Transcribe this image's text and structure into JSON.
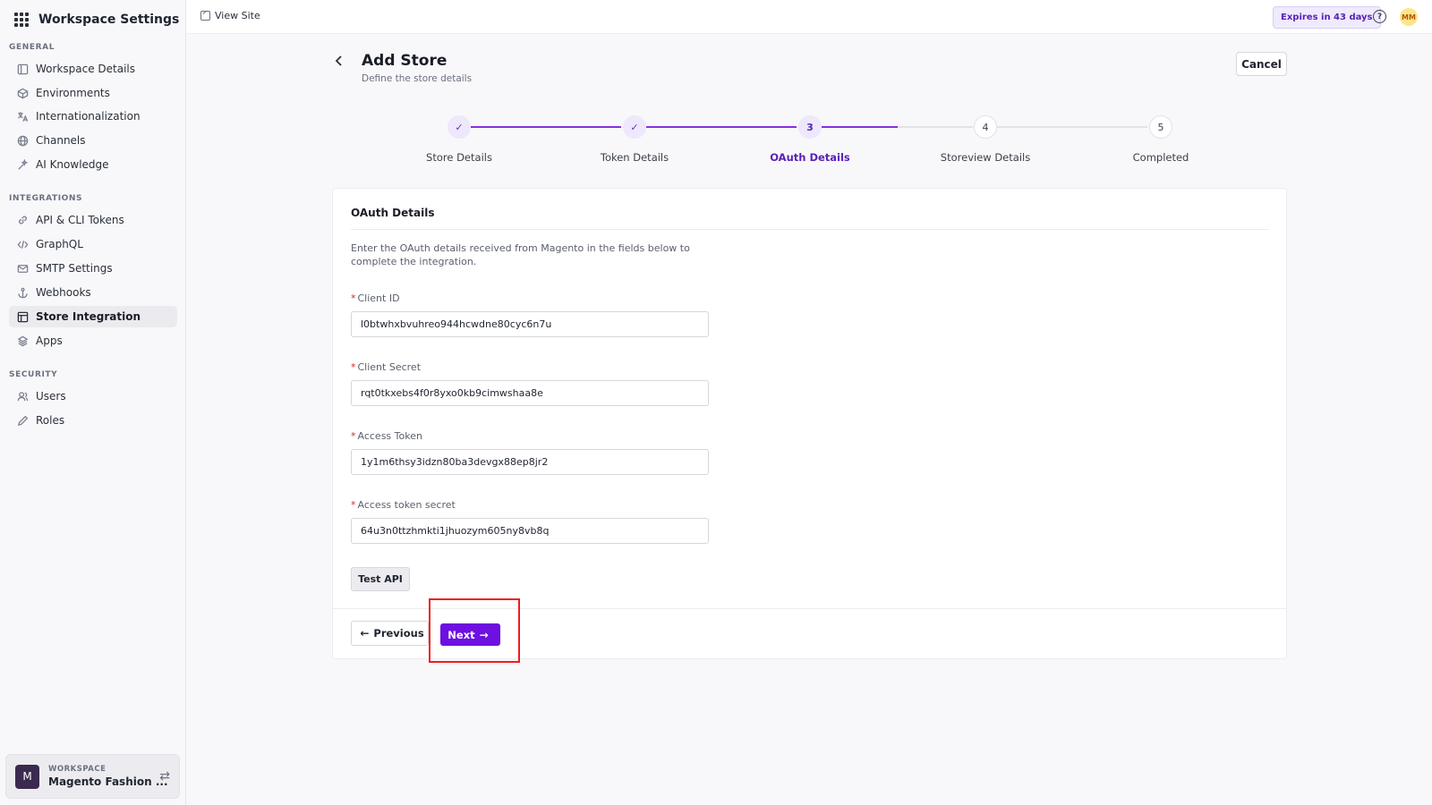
{
  "sidebar": {
    "title": "Workspace Settings",
    "sections": {
      "general": "GENERAL",
      "integrations": "INTEGRATIONS",
      "security": "SECURITY"
    },
    "general_items": [
      {
        "label": "Workspace Details",
        "icon": "layout-icon"
      },
      {
        "label": "Environments",
        "icon": "cube-icon"
      },
      {
        "label": "Internationalization",
        "icon": "translate-icon"
      },
      {
        "label": "Channels",
        "icon": "globe-icon"
      },
      {
        "label": "AI Knowledge",
        "icon": "sparkle-icon"
      }
    ],
    "integration_items": [
      {
        "label": "API & CLI Tokens",
        "icon": "link-icon"
      },
      {
        "label": "GraphQL",
        "icon": "code-icon"
      },
      {
        "label": "SMTP Settings",
        "icon": "mail-icon"
      },
      {
        "label": "Webhooks",
        "icon": "anchor-icon"
      },
      {
        "label": "Store Integration",
        "icon": "store-icon",
        "active": true
      },
      {
        "label": "Apps",
        "icon": "apps-icon"
      }
    ],
    "security_items": [
      {
        "label": "Users",
        "icon": "users-icon"
      },
      {
        "label": "Roles",
        "icon": "pen-icon"
      }
    ],
    "workspace": {
      "label": "WORKSPACE",
      "name": "Magento Fashion ...",
      "avatar": "M"
    }
  },
  "topbar": {
    "view_site": "View Site",
    "expires": "Expires in 43 days",
    "user_initials": "MM"
  },
  "page": {
    "title": "Add Store",
    "subtitle": "Define the store details",
    "cancel": "Cancel"
  },
  "stepper": {
    "steps": [
      {
        "label": "Store Details",
        "number": "1",
        "state": "done"
      },
      {
        "label": "Token Details",
        "number": "2",
        "state": "done"
      },
      {
        "label": "OAuth Details",
        "number": "3",
        "state": "current"
      },
      {
        "label": "Storeview Details",
        "number": "4",
        "state": "todo"
      },
      {
        "label": "Completed",
        "number": "5",
        "state": "todo"
      }
    ]
  },
  "form": {
    "title": "OAuth Details",
    "description": "Enter the OAuth details received from Magento in the fields below to complete the integration.",
    "fields": [
      {
        "label": "Client ID",
        "value": "l0btwhxbvuhreo944hcwdne80cyc6n7u"
      },
      {
        "label": "Client Secret",
        "value": "rqt0tkxebs4f0r8yxo0kb9cimwshaa8e"
      },
      {
        "label": "Access Token",
        "value": "1y1m6thsy3idzn80ba3devgx88ep8jr2"
      },
      {
        "label": "Access token secret",
        "value": "64u3n0ttzhmkti1jhuozym605ny8vb8q"
      }
    ],
    "test_api": "Test API",
    "previous": "Previous",
    "next": "Next"
  },
  "colors": {
    "accent": "#6d10e0",
    "highlight": "#ef1c1c"
  }
}
